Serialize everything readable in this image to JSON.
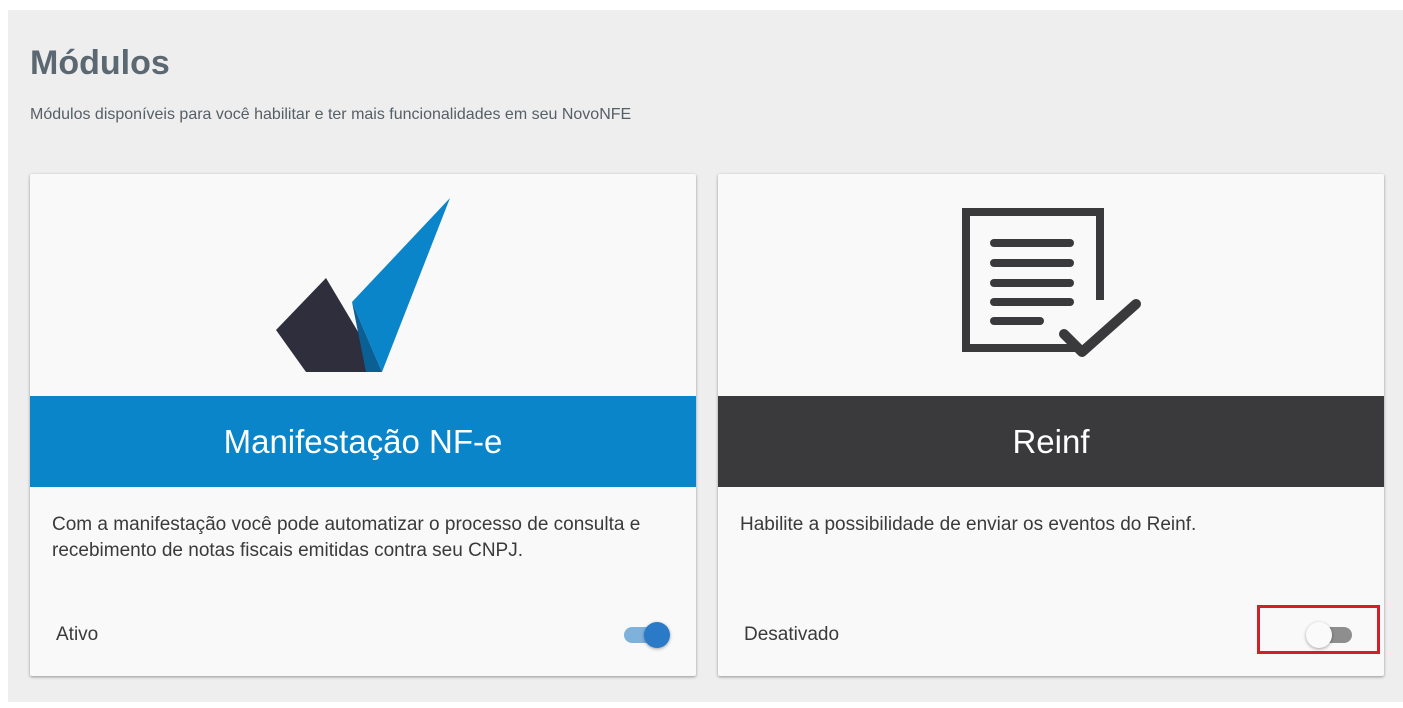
{
  "page": {
    "title": "Módulos",
    "subtitle": "Módulos disponíveis para você habilitar e ter mais funcionalidades em seu NovoNFE"
  },
  "modules": [
    {
      "title": "Manifestação NF-e",
      "description": "Com a manifestação você pode automatizar o processo de consulta e recebimento de notas fiscais emitidas contra seu CNPJ.",
      "status": "Ativo",
      "enabled": true,
      "header_color": "#0a85c9",
      "icon": "checkmark-logo-icon"
    },
    {
      "title": "Reinf",
      "description": "Habilite a possibilidade de enviar os eventos do Reinf.",
      "status": "Desativado",
      "enabled": false,
      "header_color": "#3a3a3d",
      "icon": "document-check-icon"
    }
  ],
  "colors": {
    "highlight": "#d0202a",
    "toggle_on": "#2a7ac7",
    "toggle_off": "#8e8e8e"
  }
}
